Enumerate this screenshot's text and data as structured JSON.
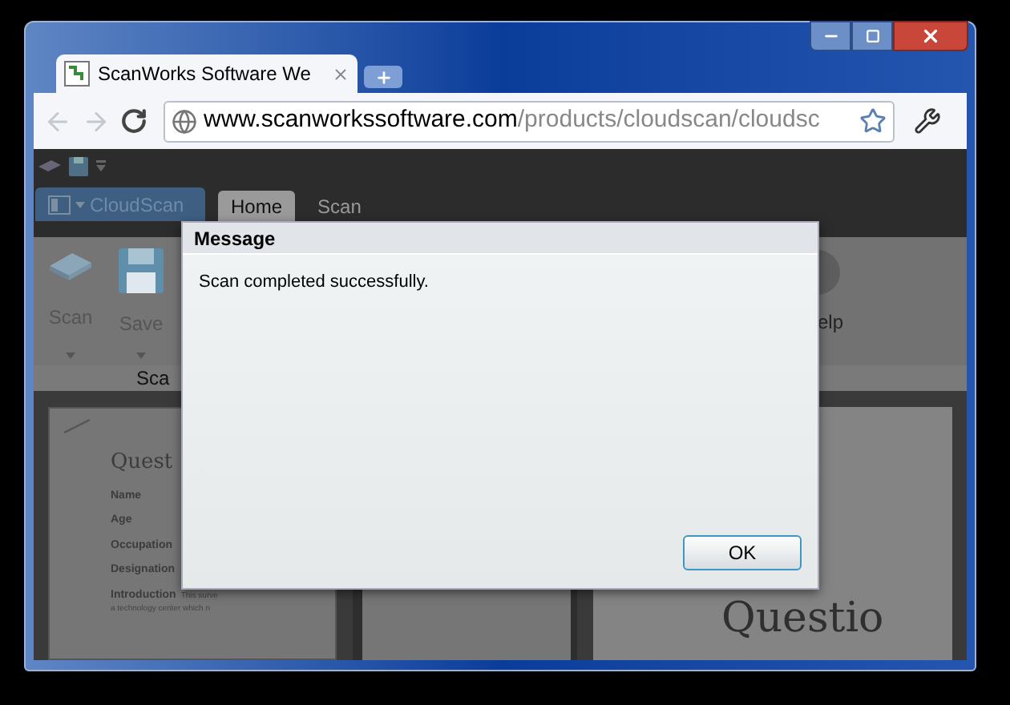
{
  "browser": {
    "tab_title": "ScanWorks Software We",
    "address": {
      "domain": "www.scanworkssoftware.com",
      "path": "/products/cloudscan/cloudsc"
    }
  },
  "app": {
    "menu_label": "CloudScan",
    "tabs": [
      {
        "label": "Home",
        "selected": true
      },
      {
        "label": "Scan",
        "selected": false
      }
    ],
    "ribbon_buttons": [
      {
        "label": "Scan",
        "kind": "scanner"
      },
      {
        "label": "Save",
        "kind": "save"
      }
    ],
    "help_label": "elp",
    "group_label": "Sca",
    "pages": [
      {
        "kind": "form",
        "title": "Quest",
        "fields": [
          "Name",
          "Age",
          "Occupation",
          "Designation"
        ],
        "intro_label": "Introduction",
        "intro_lines": [
          "This surve",
          "a technology center which n"
        ]
      },
      {
        "kind": "blank"
      },
      {
        "kind": "heading",
        "title": "Questio"
      }
    ]
  },
  "dialog": {
    "title": "Message",
    "text": "Scan completed successfully.",
    "button": "OK"
  }
}
